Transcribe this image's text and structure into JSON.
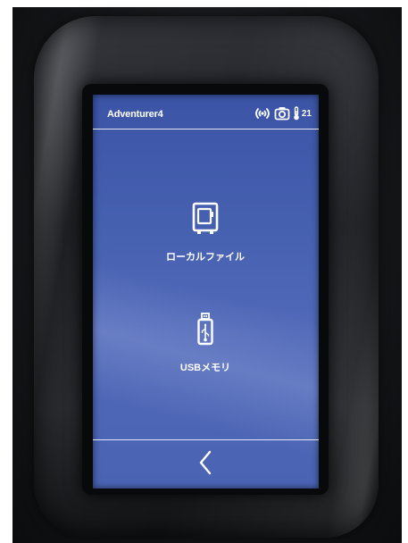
{
  "status_bar": {
    "device_name": "Adventurer4",
    "icons": [
      "wifi-signal-icon",
      "camera-icon",
      "thermometer-icon"
    ],
    "temperature": "21"
  },
  "menu": {
    "items": [
      {
        "label": "ローカルファイル",
        "icon": "local-file-icon"
      },
      {
        "label": "USBメモリ",
        "icon": "usb-drive-icon"
      }
    ]
  },
  "footer": {
    "back_icon": "chevron-left-icon"
  },
  "colors": {
    "screen_bg": "#4761b1",
    "text": "#ffffff"
  }
}
